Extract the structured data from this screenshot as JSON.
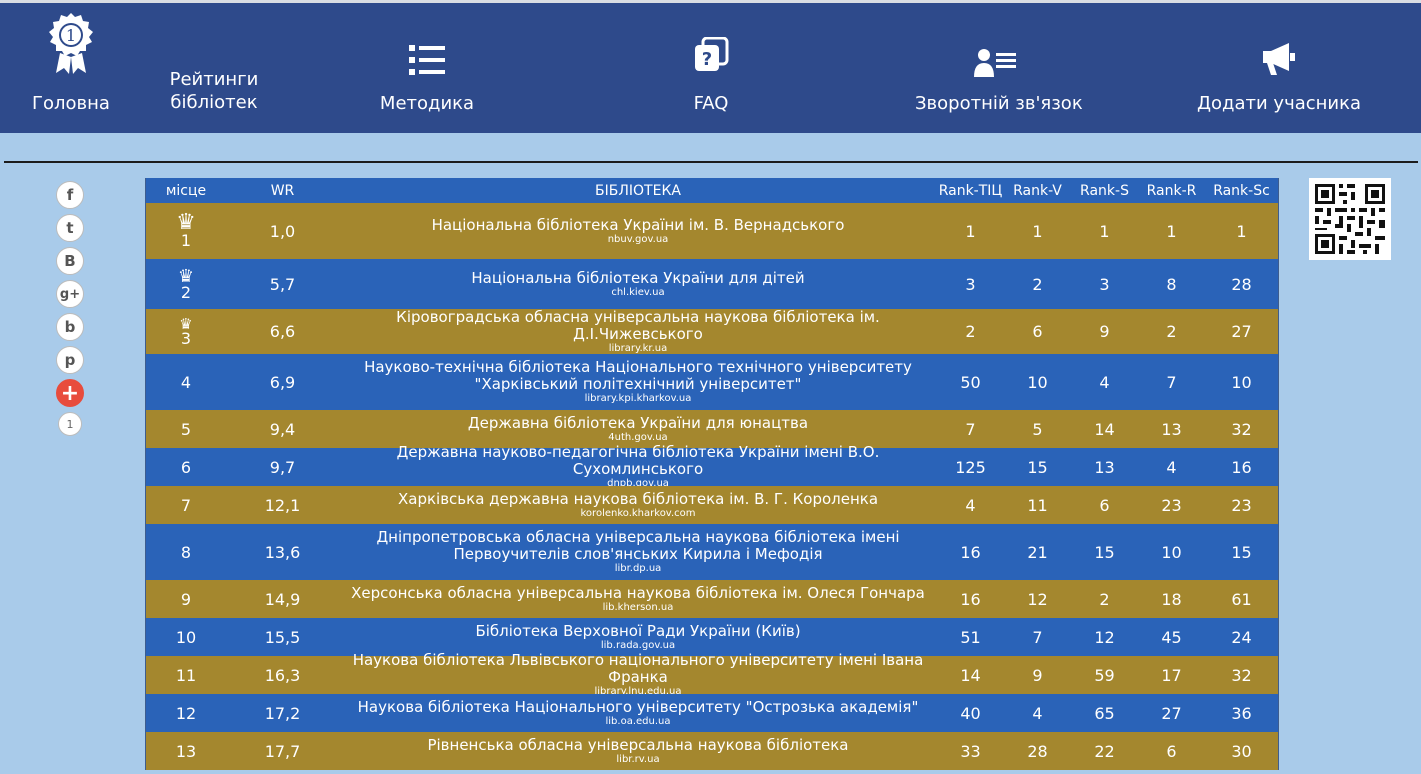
{
  "nav": {
    "items": [
      {
        "label": "Головна",
        "icon": "award-medal-icon"
      },
      {
        "label": "Рейтинги бібліотек",
        "line1": "Рейтинги",
        "line2": "бібліотек"
      },
      {
        "label": "Методика",
        "icon": "list-icon"
      },
      {
        "label": "FAQ",
        "icon": "faq-icon"
      },
      {
        "label": "Зворотній зв'язок",
        "icon": "feedback-icon"
      },
      {
        "label": "Додати учасника",
        "icon": "megaphone-icon"
      }
    ],
    "medal_number": "1"
  },
  "social": {
    "buttons": [
      "f",
      "t",
      "B",
      "g+",
      "b",
      "p",
      "+"
    ],
    "icons": [
      "facebook-icon",
      "twitter-icon",
      "vk-icon",
      "google-plus-icon",
      "blogger-icon",
      "pinterest-icon",
      "add-share-icon"
    ],
    "count": "1"
  },
  "table": {
    "headers": [
      "місце",
      "WR",
      "БІБЛІОТЕКА",
      "Rank-ТІЦ",
      "Rank-V",
      "Rank-S",
      "Rank-R",
      "Rank-Sc"
    ],
    "rows": [
      {
        "place": "1",
        "wr": "1,0",
        "name": "Національна бібліотека України ім. В. Вернадського",
        "url": "nbuv.gov.ua",
        "r": [
          "1",
          "1",
          "1",
          "1",
          "1"
        ]
      },
      {
        "place": "2",
        "wr": "5,7",
        "name": "Національна бібліотека України для дітей",
        "url": "chl.kiev.ua",
        "r": [
          "3",
          "2",
          "3",
          "8",
          "28"
        ]
      },
      {
        "place": "3",
        "wr": "6,6",
        "name": "Кіровоградська обласна універсальна наукова бібліотека ім. Д.І.Чижевського",
        "url": "library.kr.ua",
        "r": [
          "2",
          "6",
          "9",
          "2",
          "27"
        ]
      },
      {
        "place": "4",
        "wr": "6,9",
        "name": "Науково-технічна бібліотека Національного технічного університету \"Харківський політехнічний університет\"",
        "url": "library.kpi.kharkov.ua",
        "r": [
          "50",
          "10",
          "4",
          "7",
          "10"
        ]
      },
      {
        "place": "5",
        "wr": "9,4",
        "name": "Державна бібліотека України для юнацтва",
        "url": "4uth.gov.ua",
        "r": [
          "7",
          "5",
          "14",
          "13",
          "32"
        ]
      },
      {
        "place": "6",
        "wr": "9,7",
        "name": "Державна науково-педагогічна бібліотека України імені В.О. Сухомлинського",
        "url": "dnpb.gov.ua",
        "r": [
          "125",
          "15",
          "13",
          "4",
          "16"
        ]
      },
      {
        "place": "7",
        "wr": "12,1",
        "name": "Харківська державна наукова бібліотека ім. В. Г. Короленка",
        "url": "korolenko.kharkov.com",
        "r": [
          "4",
          "11",
          "6",
          "23",
          "23"
        ]
      },
      {
        "place": "8",
        "wr": "13,6",
        "name": "Дніпропетровська обласна універсальна наукова бібліотека імені Первоучителів слов'янських Кирила і Мефодія",
        "url": "libr.dp.ua",
        "r": [
          "16",
          "21",
          "15",
          "10",
          "15"
        ]
      },
      {
        "place": "9",
        "wr": "14,9",
        "name": "Херсонська обласна універсальна наукова бібліотека ім. Олеся Гончара",
        "url": "lib.kherson.ua",
        "r": [
          "16",
          "12",
          "2",
          "18",
          "61"
        ]
      },
      {
        "place": "10",
        "wr": "15,5",
        "name": "Бібліотека Верховної Ради України (Київ)",
        "url": "lib.rada.gov.ua",
        "r": [
          "51",
          "7",
          "12",
          "45",
          "24"
        ]
      },
      {
        "place": "11",
        "wr": "16,3",
        "name": "Наукова бібліотека Львівського національного університету імені Івана Франка",
        "url": "library.lnu.edu.ua",
        "r": [
          "14",
          "9",
          "59",
          "17",
          "32"
        ]
      },
      {
        "place": "12",
        "wr": "17,2",
        "name": "Наукова бібліотека Національного університету \"Острозька академія\"",
        "url": "lib.oa.edu.ua",
        "r": [
          "40",
          "4",
          "65",
          "27",
          "36"
        ]
      },
      {
        "place": "13",
        "wr": "17,7",
        "name": "Рівненська обласна універсальна наукова бібліотека",
        "url": "libr.rv.ua",
        "r": [
          "33",
          "28",
          "22",
          "6",
          "30"
        ]
      }
    ]
  },
  "colors": {
    "nav_bg": "#2e4a8b",
    "page_bg": "#a9cbea",
    "row_gold": "#a4872e",
    "row_blue": "#2a63b8"
  }
}
